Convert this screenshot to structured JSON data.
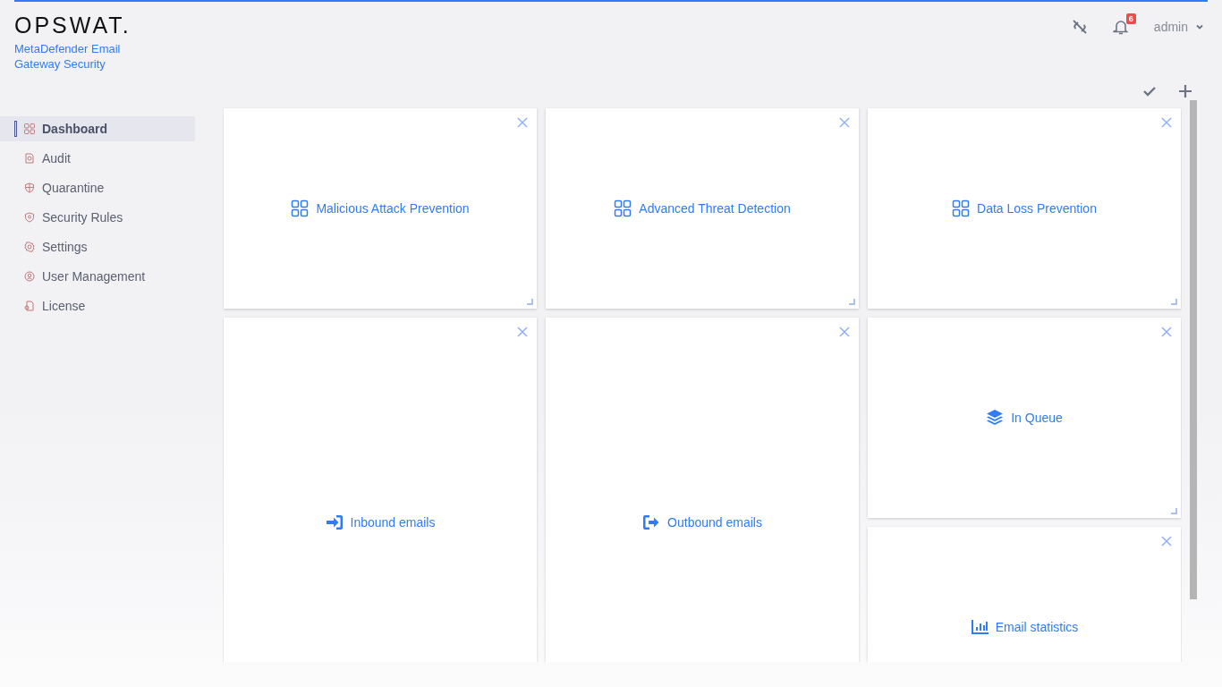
{
  "logo": {
    "wordmark": "OPSWAT.",
    "product": "MetaDefender Email Gateway Security"
  },
  "header": {
    "notifications": "6",
    "user": "admin"
  },
  "sidebar": {
    "items": [
      {
        "label": "Dashboard",
        "kind": "grid",
        "selected": true
      },
      {
        "label": "Audit",
        "kind": "audit",
        "selected": false
      },
      {
        "label": "Quarantine",
        "kind": "shield",
        "selected": false
      },
      {
        "label": "Security Rules",
        "kind": "badge",
        "selected": false
      },
      {
        "label": "Settings",
        "kind": "gear",
        "selected": false
      },
      {
        "label": "User Management",
        "kind": "user",
        "selected": false
      },
      {
        "label": "License",
        "kind": "license",
        "selected": false
      }
    ]
  },
  "widgets": [
    {
      "title": "Malicious Attack Prevention",
      "kind": "grid",
      "tall": false,
      "resize_handle": true
    },
    {
      "title": "Advanced Threat Detection",
      "kind": "grid",
      "tall": false,
      "resize_handle": true
    },
    {
      "title": "Data Loss Prevention",
      "kind": "grid",
      "tall": false,
      "resize_handle": true
    },
    {
      "title": "Inbound emails",
      "kind": "sign-in",
      "tall": true
    },
    {
      "title": "Outbound emails",
      "kind": "sign-out",
      "tall": true
    },
    {
      "title": "In Queue",
      "kind": "layers",
      "tall": false,
      "resize_handle": true
    },
    {
      "title": "Email statistics",
      "kind": "chart",
      "tall": false
    }
  ]
}
